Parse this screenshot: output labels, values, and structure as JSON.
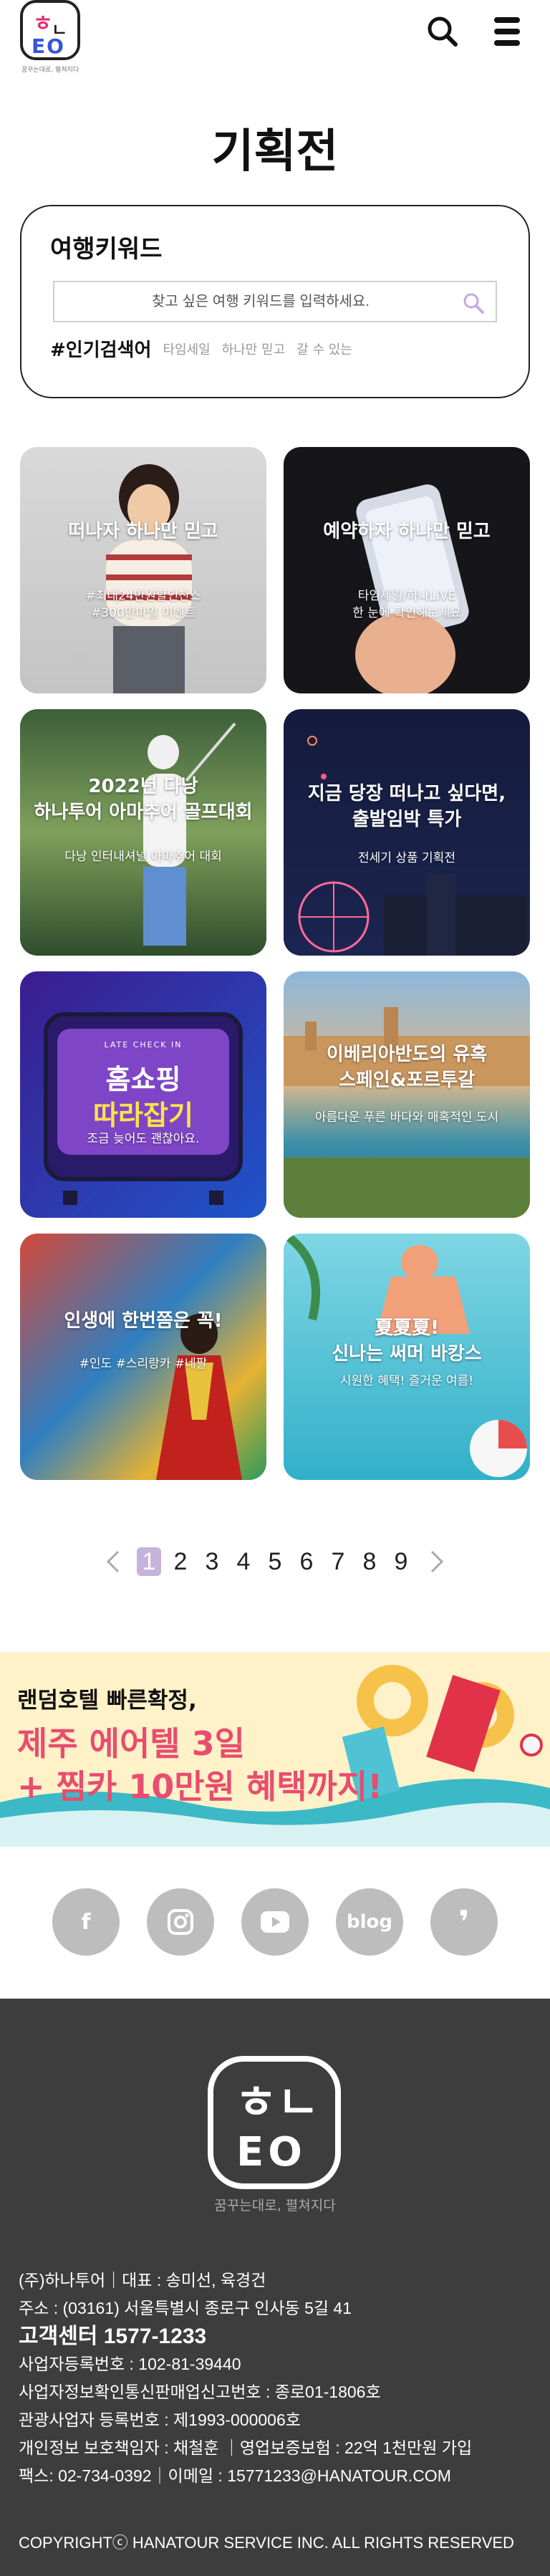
{
  "header": {
    "logo_text": "하나투어",
    "logo_slogan": "꿈꾸는대로, 펼쳐지다",
    "search_icon": "search-icon",
    "menu_icon": "menu-icon"
  },
  "page_title": "기획전",
  "search": {
    "title": "여행키워드",
    "placeholder": "찾고 싶은 여행 키워드를 입력하세요.",
    "popular_label": "#인기검색어",
    "popular_tags": [
      "타임세일",
      "하나만 믿고",
      "갈 수 있는"
    ]
  },
  "tiles": [
    {
      "title": "떠나자 하나만 믿고",
      "sub1": "#최대24만원할인찬스",
      "sub2": "#300만마일 이벤트"
    },
    {
      "title": "예약하자 하나만 믿고",
      "sub1": "타임세일/하나LIVE",
      "sub2": "한 눈에 확인해보세요"
    },
    {
      "title": "2022년 다낭",
      "title2": "하나투어 아마추어 골프대회",
      "sub1": "다낭 인터내셔널 아마추어 대회"
    },
    {
      "title": "지금 당장 떠나고 싶다면,",
      "title2": "출발임박 특가",
      "sub1": "전세기 상품 기획전"
    },
    {
      "tv_top": "LATE CHECK IN",
      "tv_line1": "홈쇼핑",
      "tv_line2": "따라잡기",
      "sub1": "조금 늦어도 괜찮아요."
    },
    {
      "title": "이베리아반도의 유혹",
      "title2": "스페인&포르투갈",
      "sub1": "아름다운 푸른 바다와 매혹적인 도시"
    },
    {
      "title": "인생에 한번쯤은 꼭!",
      "sub1": "#인도 #스리랑카 #네팔"
    },
    {
      "title": "夏夏夏!",
      "title2": "신나는 써머 바캉스",
      "sub1": "시원한 혜택! 즐거운 여름!"
    }
  ],
  "pagination": {
    "pages": [
      "1",
      "2",
      "3",
      "4",
      "5",
      "6",
      "7",
      "8",
      "9"
    ],
    "current": "1",
    "active_color": "#c6b3dc"
  },
  "banner": {
    "line1": "랜덤호텔 빠른확정,",
    "line2": "제주 에어텔 3일",
    "line3": "+ 찜카 10만원 혜택까지!",
    "accent_color": "#e94c6f"
  },
  "social": [
    {
      "name": "facebook",
      "label": "f"
    },
    {
      "name": "instagram",
      "label": ""
    },
    {
      "name": "youtube",
      "label": ""
    },
    {
      "name": "blog",
      "label": "blog"
    },
    {
      "name": "kakao-story",
      "label": "❜"
    }
  ],
  "footer": {
    "logo_slogan": "꿈꾸는대로, 펼쳐지다",
    "company": "(주)하나투어｜대표 : 송미선, 육경건",
    "address": "주소 : (03161) 서울특별시 종로구 인사동 5길 41",
    "cs": "고객센터 1577-1233",
    "biz_no": "사업자등록번호 : 102-81-39440",
    "ecommerce": "사업자정보확인통신판매업신고번호 : 종로01-1806호",
    "tour_reg": "관광사업자 등록번호 : 제1993-000006호",
    "privacy": "개인정보 보호책임자 : 채철훈 ｜영업보증보험 : 22억 1천만원 가입",
    "contact": "팩스: 02-734-0392｜이메일 : 15771233@HANATOUR.COM",
    "copyright": "COPYRIGHTⓒ HANATOUR SERVICE INC. ALL RIGHTS RESERVED"
  }
}
